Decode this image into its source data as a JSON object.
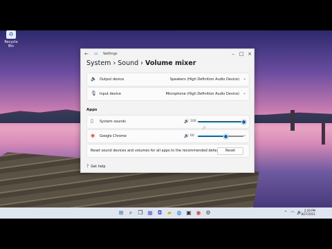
{
  "desktop": {
    "icon_label": "Recycle Bin"
  },
  "window": {
    "title": "Settings",
    "breadcrumb": [
      "System",
      "Sound",
      "Volume mixer"
    ],
    "controls": [
      "minimize-icon",
      "maximize-icon",
      "close-icon"
    ]
  },
  "devices": {
    "output_label": "Output device",
    "output_value": "Speakers (High Definition Audio Device)",
    "input_label": "Input device",
    "input_value": "Microphone (High Definition Audio Device)"
  },
  "apps": {
    "section_title": "Apps",
    "items": [
      {
        "name": "System sounds",
        "volume": 100
      },
      {
        "name": "Google Chrome",
        "volume": 60
      }
    ]
  },
  "reset": {
    "text": "Reset sound devices and volumes for all apps to the recommended defaults",
    "button": "Reset"
  },
  "help": {
    "label": "Get help"
  },
  "taskbar": {
    "time": "2:39 PM",
    "date": "8/27/2021"
  },
  "colors": {
    "accent": "#0067c0",
    "taskbar": "#dfe6ef"
  }
}
